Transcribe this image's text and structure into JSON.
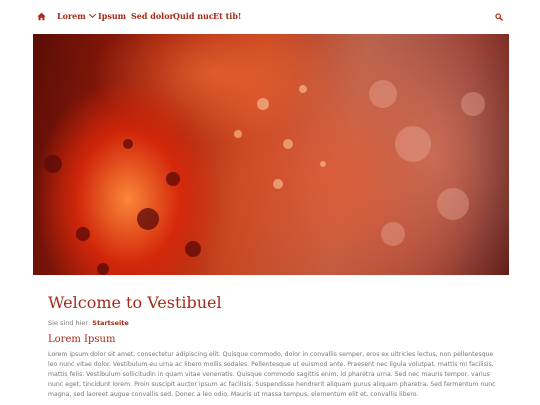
{
  "nav": {
    "home_icon": "home-icon",
    "items": [
      {
        "label": "Lorem",
        "has_dropdown": true
      },
      {
        "label": "Ipsum"
      },
      {
        "label": "Sed dolor"
      },
      {
        "label": "Quid nuc"
      },
      {
        "label": "Et tib!"
      }
    ],
    "search_icon": "search-icon"
  },
  "hero": {
    "image": "red-lantern-photo"
  },
  "page": {
    "title": "Welcome to Vestibuel",
    "breadcrumb": {
      "prefix": "Sie sind hier:",
      "current": "Startseite"
    },
    "subtitle": "Lorem Ipsum",
    "body": "Lorem ipsum dolor sit amet, consectetur adipiscing elit. Quisque commodo, dolor in convallis semper, eros ex ultricies lectus, non pellentesque leo nunc vitae dolor. Vestibulum eu urna ac libero mollis sodales. Pellentesque ut euismod ante. Praesent nec ligula volutpat, mattis mi facilisis, mattis felis. Vestibulum sollicitudin in quam vitae venenatis. Quisque commodo sagittis enim, id pharetra urna. Sed nec mauris tempor, varius nunc eget, tincidunt lorem. Proin suscipit auctor ipsum ac facilisis. Suspendisse hendrerit aliquam purus aliquam pharetra. Sed fermentum nunc magna, sed laoreet augue convallis sed. Donec a leo odio. Mauris ut massa tempus, elementum elit et, convallis libero."
  },
  "colors": {
    "accent": "#a52a17",
    "text": "#777777"
  }
}
